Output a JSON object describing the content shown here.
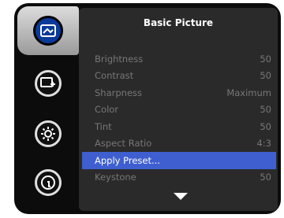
{
  "menu": {
    "title": "Basic Picture",
    "tabs": [
      {
        "name": "picture",
        "icon": "picture-icon",
        "selected": true
      },
      {
        "name": "advanced-picture",
        "icon": "advanced-picture-icon",
        "selected": false
      },
      {
        "name": "settings",
        "icon": "settings-icon",
        "selected": false
      },
      {
        "name": "info",
        "icon": "info-icon",
        "selected": false
      }
    ],
    "items": [
      {
        "label": "Brightness",
        "value": "50"
      },
      {
        "label": "Contrast",
        "value": "50"
      },
      {
        "label": "Sharpness",
        "value": "Maximum"
      },
      {
        "label": "Color",
        "value": "50"
      },
      {
        "label": "Tint",
        "value": "50"
      },
      {
        "label": "Aspect Ratio",
        "value": "4:3"
      },
      {
        "label": "Apply Preset...",
        "value": ""
      },
      {
        "label": "Keystone",
        "value": "50"
      }
    ],
    "highlight_color": "#3f5fd0"
  }
}
